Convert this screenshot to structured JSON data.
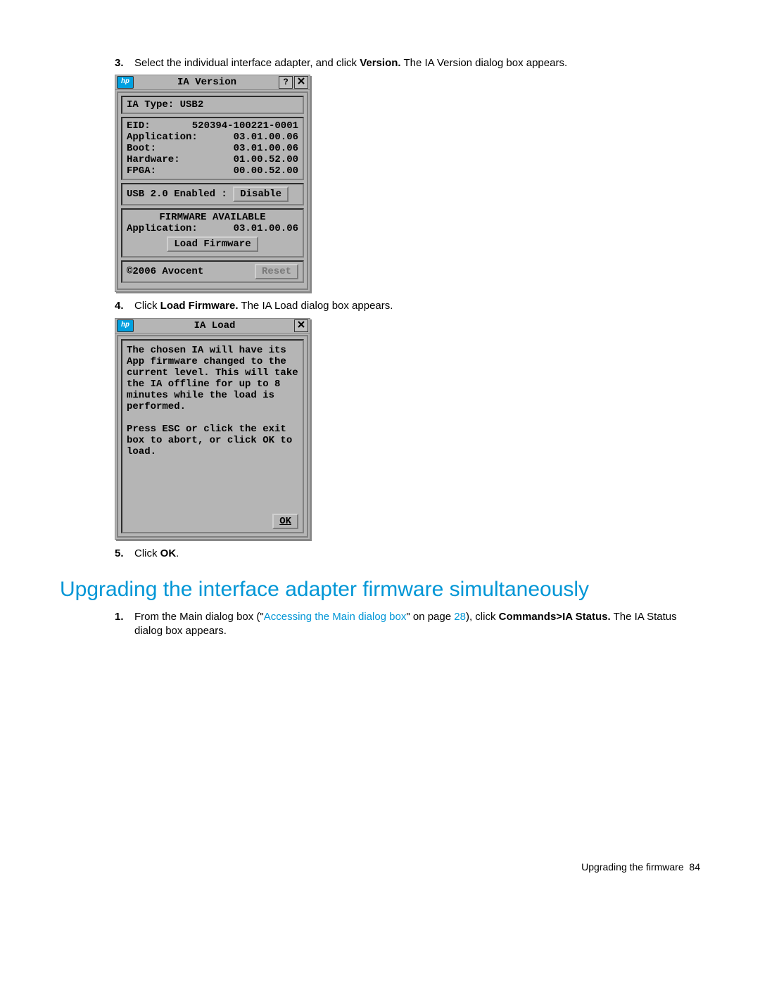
{
  "steps": {
    "s3": {
      "num": "3.",
      "pre": "Select the individual interface adapter, and click ",
      "bold": "Version.",
      "post": " The IA Version dialog box appears."
    },
    "s4": {
      "num": "4.",
      "pre": "Click ",
      "bold": "Load Firmware.",
      "post": " The IA Load dialog box appears."
    },
    "s5": {
      "num": "5.",
      "pre": "Click ",
      "bold": "OK",
      "post": "."
    }
  },
  "dialog_version": {
    "title": "IA Version",
    "hp_icon": "hp",
    "help_btn": "?",
    "ia_type": {
      "label": "IA Type:",
      "value": "USB2"
    },
    "eid": {
      "label": "EID:",
      "value": "520394-100221-0001"
    },
    "app": {
      "label": "Application:",
      "value": "03.01.00.06"
    },
    "boot": {
      "label": "Boot:",
      "value": "03.01.00.06"
    },
    "hw": {
      "label": "Hardware:",
      "value": "01.00.52.00"
    },
    "fpga": {
      "label": "FPGA:",
      "value": "00.00.52.00"
    },
    "usb_label": "USB 2.0 Enabled :",
    "disable_btn": "Disable",
    "fw_avail": "FIRMWARE AVAILABLE",
    "fw_app": {
      "label": "Application:",
      "value": "03.01.00.06"
    },
    "load_fw_btn": "Load Firmware",
    "copyright": "©2006 Avocent",
    "reset_btn": "Reset"
  },
  "dialog_load": {
    "title": "IA Load",
    "hp_icon": "hp",
    "message": "The chosen IA will have its App firmware changed to the current level. This will take the IA offline for up to 8 minutes while the load is performed.\n\nPress ESC or click the exit box to abort, or click OK to load.",
    "ok_btn": "OK"
  },
  "heading": "Upgrading the interface adapter firmware simultaneously",
  "step1": {
    "num": "1.",
    "pre": "From the Main dialog box (\"",
    "link": "Accessing the Main dialog box",
    "mid": "\" on page ",
    "pageref": "28",
    "post1": "), click ",
    "bold": "Commands>IA Status.",
    "post2": " The IA Status dialog box appears."
  },
  "footer": {
    "text": "Upgrading the firmware",
    "page": "84"
  }
}
